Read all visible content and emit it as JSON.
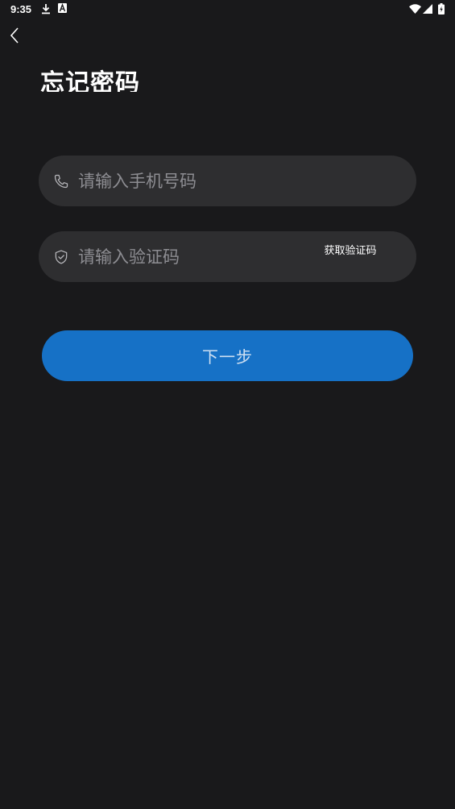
{
  "status_bar": {
    "time": "9:35",
    "icons": [
      "download-icon",
      "font-a-icon",
      "wifi-icon",
      "signal-icon",
      "battery-icon"
    ]
  },
  "header": {
    "back_icon": "chevron-left-icon",
    "title": "忘记密码"
  },
  "form": {
    "phone": {
      "icon": "phone-icon",
      "value": "",
      "placeholder": "请输入手机号码"
    },
    "code": {
      "icon": "shield-check-icon",
      "value": "",
      "placeholder": "请输入验证码",
      "get_code_label": "获取验证码"
    },
    "next_label": "下一步"
  },
  "colors": {
    "background": "#19191b",
    "input_background": "#2e2e30",
    "primary": "#1671c6",
    "placeholder": "#8d8d92"
  }
}
